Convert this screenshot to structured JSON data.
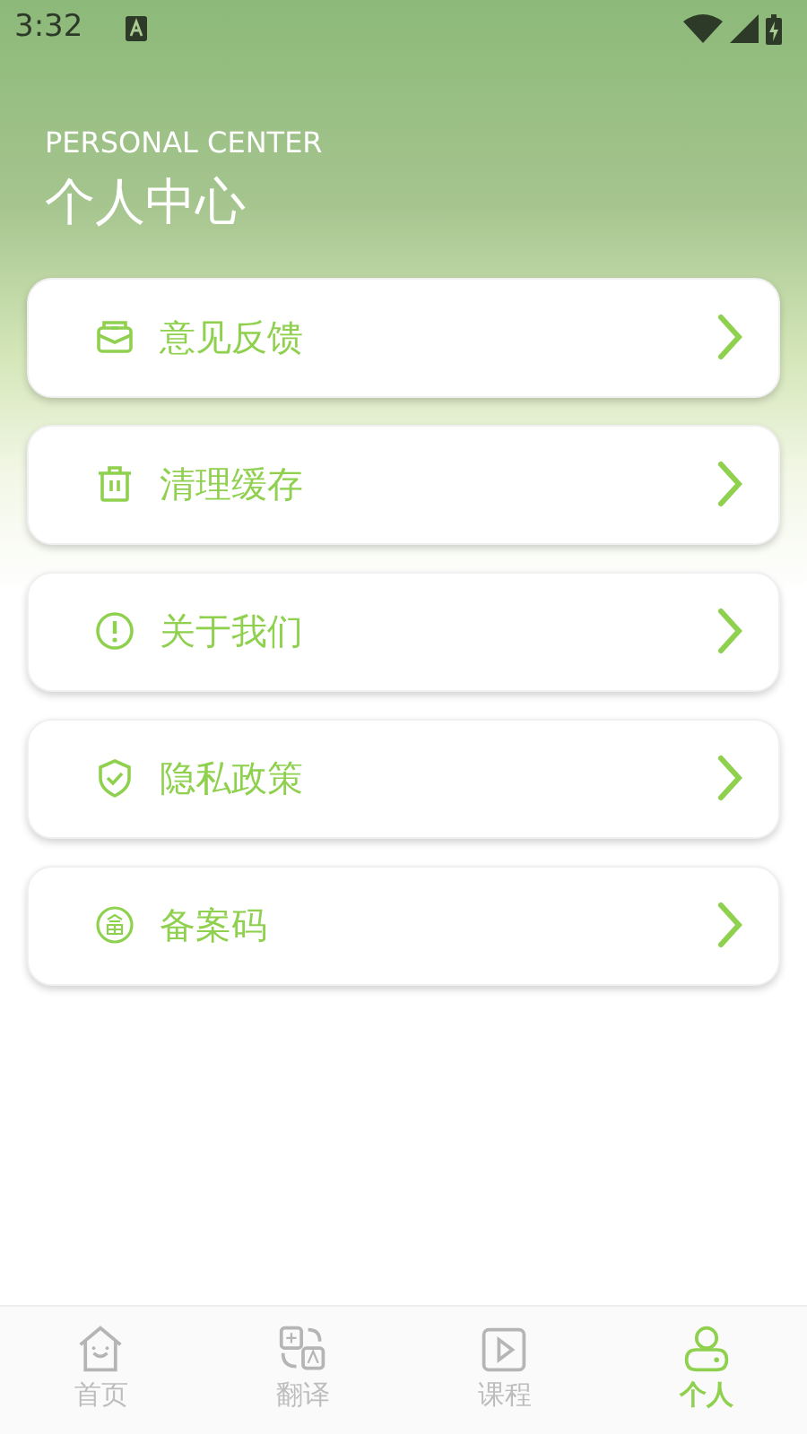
{
  "status_bar": {
    "time": "3:32"
  },
  "header": {
    "subtitle": "PERSONAL CENTER",
    "title": "个人中心"
  },
  "menu": [
    {
      "label": "意见反馈"
    },
    {
      "label": "清理缓存"
    },
    {
      "label": "关于我们"
    },
    {
      "label": "隐私政策"
    },
    {
      "label": "备案码"
    }
  ],
  "tabs": [
    {
      "label": "首页",
      "selected": false
    },
    {
      "label": "翻译",
      "selected": false
    },
    {
      "label": "课程",
      "selected": false
    },
    {
      "label": "个人",
      "selected": true
    }
  ]
}
